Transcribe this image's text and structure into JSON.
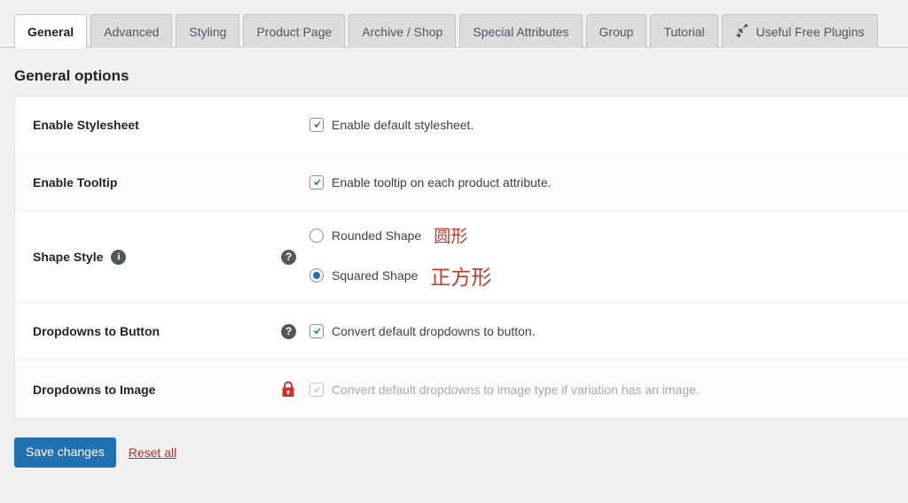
{
  "tabs": [
    {
      "label": "General",
      "active": true,
      "icon": null
    },
    {
      "label": "Advanced",
      "active": false,
      "icon": null
    },
    {
      "label": "Styling",
      "active": false,
      "icon": null
    },
    {
      "label": "Product Page",
      "active": false,
      "icon": null
    },
    {
      "label": "Archive / Shop",
      "active": false,
      "icon": null
    },
    {
      "label": "Special Attributes",
      "active": false,
      "icon": null
    },
    {
      "label": "Group",
      "active": false,
      "icon": null
    },
    {
      "label": "Tutorial",
      "active": false,
      "icon": null
    },
    {
      "label": "Useful Free Plugins",
      "active": false,
      "icon": "megaphone-icon"
    }
  ],
  "page": {
    "heading": "General options"
  },
  "rows": [
    {
      "label": "Enable Stylesheet",
      "info_icon": null,
      "help_icon": null,
      "control": "checkbox",
      "checked": true,
      "disabled": false,
      "field_label": "Enable default stylesheet.",
      "annotation": null
    },
    {
      "label": "Enable Tooltip",
      "info_icon": null,
      "help_icon": null,
      "control": "checkbox",
      "checked": true,
      "disabled": false,
      "field_label": "Enable tooltip on each product attribute.",
      "annotation": null
    },
    {
      "label": "Shape Style",
      "info_icon": "info-icon",
      "help_icon": "help-icon",
      "control": "radio-group",
      "options": [
        {
          "label": "Rounded Shape",
          "selected": false,
          "annotation": "圆形"
        },
        {
          "label": "Squared Shape",
          "selected": true,
          "annotation": "正方形"
        }
      ]
    },
    {
      "label": "Dropdowns to Button",
      "info_icon": null,
      "help_icon": "help-icon",
      "control": "checkbox",
      "checked": true,
      "disabled": false,
      "field_label": "Convert default dropdowns to button.",
      "annotation": null
    },
    {
      "label": "Dropdowns to Image",
      "info_icon": null,
      "help_icon": "lock-icon",
      "control": "checkbox",
      "checked": true,
      "disabled": true,
      "field_label": "Convert default dropdowns to image type if variation has an image.",
      "annotation": null
    }
  ],
  "footer": {
    "save_label": "Save changes",
    "reset_label": "Reset all"
  },
  "colors": {
    "accent_blue": "#2271b1",
    "danger_red": "#b32d2e",
    "annotation_red": "#c0392b",
    "lock_red": "#c9322e",
    "page_bg": "#f0f0f1"
  }
}
